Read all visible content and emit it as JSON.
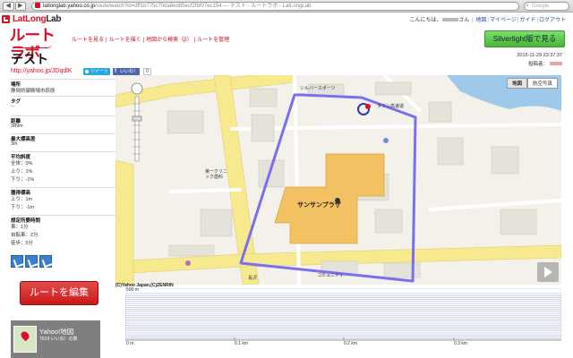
{
  "browser": {
    "url_host": "latlonglab.yahoo.co.jp",
    "url_rest": "/route/watch?id=dff1b775c70da8ed85ecf2fbf07ec154 — テスト - ルートラボ - LatLongLab",
    "search_placeholder": "Google"
  },
  "header": {
    "logo_lat": "LatLong",
    "logo_lab": "Lab",
    "greeting": "こんにちは、",
    "honorific": "さん",
    "links": [
      "地図",
      "マイページ",
      "ガイド",
      "ログアウト"
    ]
  },
  "brand": {
    "title": "ルートラボ"
  },
  "menu": [
    "ルートを見る",
    "ルートを描く",
    "地図から検索（β）",
    "ルートを管理"
  ],
  "silverlight_label": "Silverlight版で見る",
  "route": {
    "title": "テスト",
    "url": "http://yahoo.jp/JDqdlK",
    "tweet_label": "ツイート",
    "like_label": "いいね！",
    "like_count": "0",
    "date": "2015-11-29 23:37:37",
    "author_label": "投稿者："
  },
  "details": {
    "place_label": "場所",
    "place": "静岡県御殿場市萩原",
    "tag_label": "タグ",
    "tag": "--",
    "distance_label": "距離",
    "distance": "389m",
    "elev_diff_label": "最大標高差",
    "elev_diff": "3m",
    "slope_label": "平均斜度",
    "slope_all": "全体：0%",
    "slope_up": "上り：1%",
    "slope_down": "下り：-1%",
    "gain_label": "獲得標高",
    "gain_up": "上り：1m",
    "gain_down": "下り：-1m",
    "time_label": "想定所要時間",
    "time_car": "車：1分",
    "time_bike": "自転車：2分",
    "time_walk": "徒歩：5分"
  },
  "edit_button": "ルートを編集",
  "yahoo_banner": {
    "title": "Yahoo!地図",
    "sub": "7619 いいね！の数"
  },
  "map": {
    "type_map": "地図",
    "type_aerial": "航空写真",
    "copyright": "(C)Yahoo Japan,(C)ZENRIN",
    "labels": {
      "store": "サンサンプラザ",
      "silver": "シルバースポーツ",
      "town": "タウン高速道",
      "dental": "第一クリニック歯科",
      "misc1": "コミュニティ",
      "misc2": "長沢"
    }
  },
  "elevation": {
    "y_top": "500 m",
    "x_ticks": [
      "0 m",
      "0.1 km",
      "0.2 km",
      "0.3 km"
    ]
  }
}
